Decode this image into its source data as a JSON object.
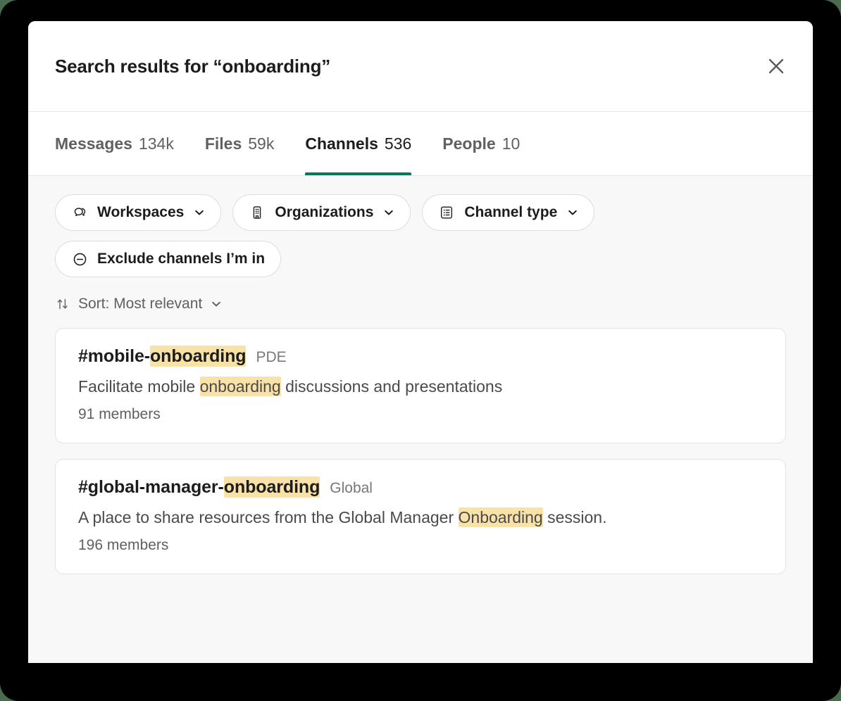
{
  "window": {
    "frame_color": "#000000",
    "backdrop_color": "#4a6b4e"
  },
  "header": {
    "title": "Search results for “onboarding”",
    "close_icon": "close-icon"
  },
  "tabs": [
    {
      "label": "Messages",
      "count": "134k",
      "active": false
    },
    {
      "label": "Files",
      "count": "59k",
      "active": false
    },
    {
      "label": "Channels",
      "count": "536",
      "active": true
    },
    {
      "label": "People",
      "count": "10",
      "active": false
    }
  ],
  "tab_accent_color": "#007a5a",
  "filters": [
    {
      "label": "Workspaces",
      "icon": "workspaces-icon",
      "has_chevron": true
    },
    {
      "label": "Organizations",
      "icon": "building-icon",
      "has_chevron": true
    },
    {
      "label": "Channel type",
      "icon": "list-document-icon",
      "has_chevron": true
    },
    {
      "label": "Exclude channels I’m in",
      "icon": "circle-minus-icon",
      "has_chevron": false
    }
  ],
  "sort": {
    "label": "Sort: Most relevant",
    "icon": "sort-arrows-icon",
    "chevron": "chevron-down-icon"
  },
  "highlight_color": "#f8e2a8",
  "results": [
    {
      "name_prefix": "#mobile-",
      "name_highlight": "onboarding",
      "name_suffix": "",
      "org": "PDE",
      "desc_before": "Facilitate mobile ",
      "desc_highlight": "onboarding",
      "desc_after": " discussions and presentations",
      "members": "91 members"
    },
    {
      "name_prefix": "#global-manager-",
      "name_highlight": "onboarding",
      "name_suffix": "",
      "org": "Global",
      "desc_before": "A place to share resources from the Global Manager ",
      "desc_highlight": "Onboarding",
      "desc_after": " session.",
      "members": "196 members"
    }
  ]
}
